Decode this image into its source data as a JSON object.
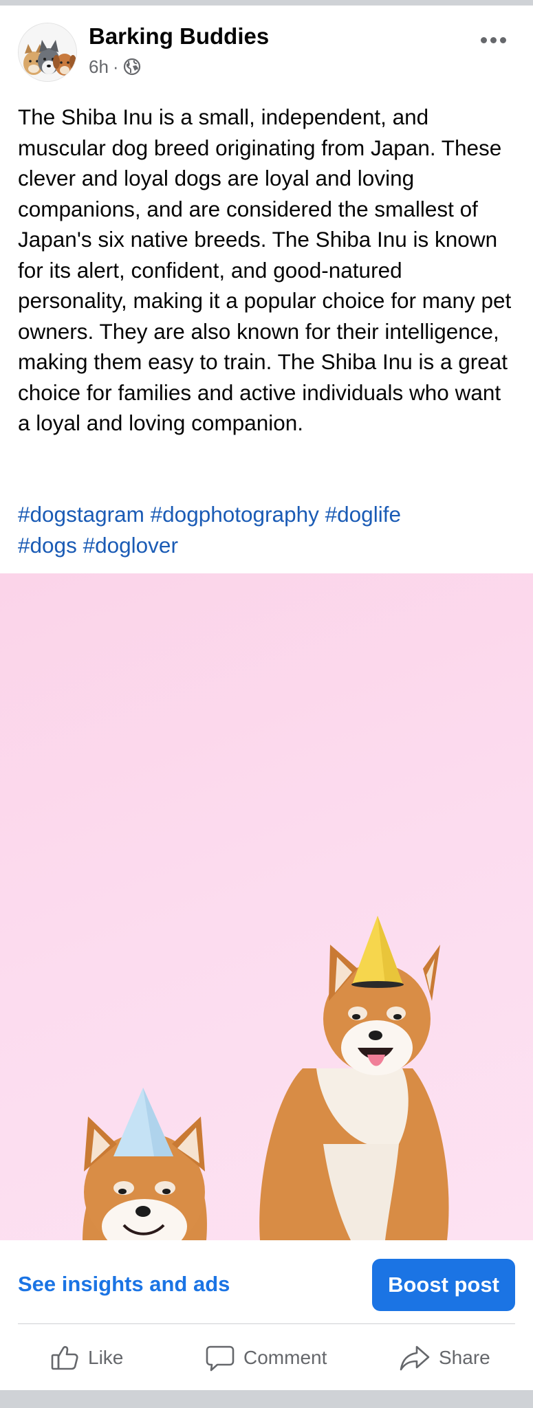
{
  "post": {
    "page_name": "Barking Buddies",
    "time": "6h",
    "separator": "·",
    "audience_icon": "globe-icon",
    "more_icon": "more-options-icon",
    "text": "The Shiba Inu is a small, independent, and muscular dog breed originating from Japan. These clever and loyal dogs are loyal and loving companions, and are considered the smallest of Japan's six native breeds. The Shiba Inu is known for its alert, confident, and good-natured personality, making it a popular choice for many pet owners. They are also known for their intelligence, making them easy to train. The Shiba Inu is a great choice for families and active individuals who want a loyal and loving companion.",
    "hashtags": [
      "#dogstagram",
      "#dogphotography",
      "#doglife",
      "#dogs",
      "#doglover"
    ]
  },
  "promo": {
    "insights_label": "See insights and ads",
    "boost_label": "Boost post"
  },
  "actions": {
    "like_label": "Like",
    "comment_label": "Comment",
    "share_label": "Share"
  },
  "colors": {
    "brand_blue": "#1b74e4",
    "hashtag_blue": "#1a5bb5",
    "photo_background": "#fcdcef",
    "muted_text": "#65676b"
  }
}
